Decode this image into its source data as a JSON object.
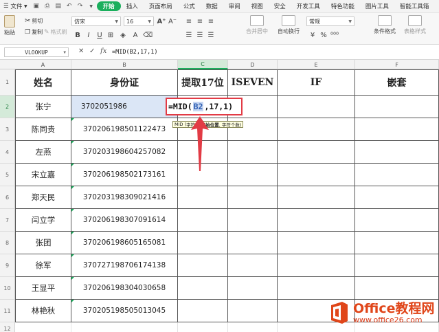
{
  "menubar": {
    "file_menu": "文件",
    "tabs": [
      "开始",
      "插入",
      "页面布局",
      "公式",
      "数据",
      "审阅",
      "视图",
      "安全",
      "开发工具",
      "特色功能",
      "图片工具",
      "智能工具箱"
    ],
    "active_tab": "开始"
  },
  "ribbon": {
    "paste": "粘贴",
    "cut": "剪切",
    "copy": "复制",
    "format_painter": "格式刷",
    "font_name": "仿宋",
    "font_size": "16",
    "merge_center": "合并居中",
    "wrap_text": "自动换行",
    "number_format": "常规",
    "conditional_format": "条件格式",
    "table_style": "表格样式"
  },
  "formula_bar": {
    "name_box": "VLOOKUP",
    "cancel_icon": "✕",
    "confirm_icon": "✓",
    "fx_label": "fx",
    "formula": "=MID(B2,17,1)"
  },
  "sheet": {
    "columns": [
      "A",
      "B",
      "C",
      "D",
      "E",
      "F"
    ],
    "rows": [
      "1",
      "2",
      "3",
      "4",
      "5",
      "6",
      "7",
      "8",
      "9",
      "10",
      "11",
      "12"
    ],
    "headers": [
      "姓名",
      "身份证",
      "提取17位",
      "ISEVEN",
      "IF",
      "嵌套"
    ],
    "names": [
      "张宁",
      "陈同贵",
      "左燕",
      "宋立嘉",
      "郑天民",
      "闫立学",
      "张团",
      "徐军",
      "王显平",
      "林艳秋"
    ],
    "ids": [
      "3702051986",
      "370206198501122473",
      "370203198604257082",
      "370206198502173161",
      "370203198309021416",
      "370206198307091614",
      "370206198605165081",
      "370727198706174138",
      "370206198304030658",
      "370205198505013045"
    ],
    "edit_cell": {
      "prefix": "=MID(",
      "ref": "B2",
      "suffix": ",17,1)"
    },
    "tooltip": {
      "func": "MID (",
      "arg1": "字符串, ",
      "arg2": "开始位置",
      "arg3": ", 字符个数)"
    }
  },
  "watermark": {
    "brand": "Office教程网",
    "url": "www.office26.com"
  },
  "colors": {
    "accent_green": "#1aaf5d",
    "highlight_red": "#e23b45",
    "watermark_orange": "#e0461a"
  }
}
